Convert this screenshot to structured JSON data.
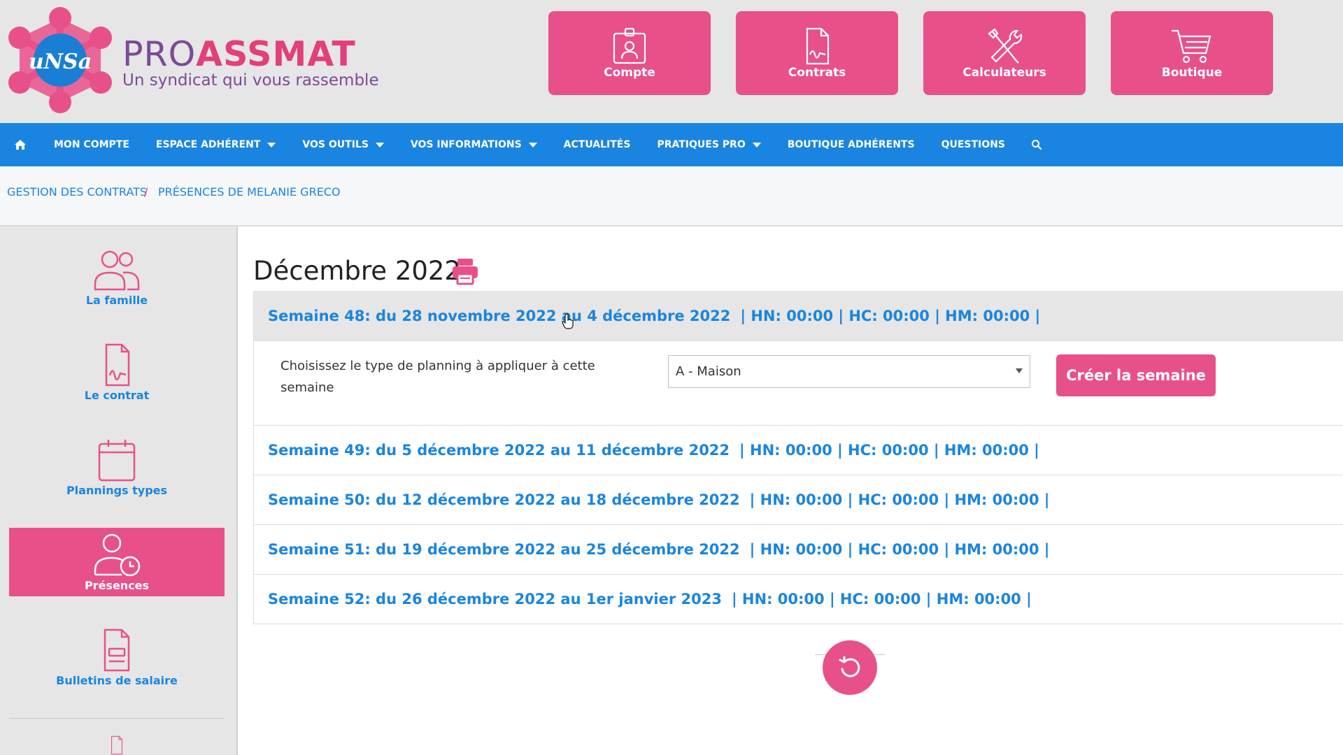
{
  "brand": {
    "logo_text": "uNSa",
    "name_part1": "PRO",
    "name_part2": "ASSMAT",
    "tagline": "Un syndicat qui vous rassemble"
  },
  "colors": {
    "pink": "#e8508a",
    "blue": "#1a85e0",
    "purple": "#7b4b96",
    "header_bg": "#e6e6e6"
  },
  "top_buttons": [
    {
      "label": "Compte",
      "icon": "id-badge-icon"
    },
    {
      "label": "Contrats",
      "icon": "contract-document-icon"
    },
    {
      "label": "Calculateurs",
      "icon": "tools-icon"
    },
    {
      "label": "Boutique",
      "icon": "shopping-cart-icon"
    }
  ],
  "nav": {
    "home_icon": "home-icon",
    "items": [
      {
        "label": "MON COMPTE",
        "dropdown": false
      },
      {
        "label": "ESPACE ADHÉRENT",
        "dropdown": true
      },
      {
        "label": "VOS OUTILS",
        "dropdown": true
      },
      {
        "label": "VOS INFORMATIONS",
        "dropdown": true
      },
      {
        "label": "ACTUALITÉS",
        "dropdown": false
      },
      {
        "label": "PRATIQUES PRO",
        "dropdown": true
      },
      {
        "label": "BOUTIQUE ADHÉRENTS",
        "dropdown": false
      },
      {
        "label": "QUESTIONS",
        "dropdown": false
      }
    ],
    "search_icon": "search-icon"
  },
  "breadcrumb": {
    "items": [
      "GESTION DES CONTRATS",
      "PRÉSENCES DE MELANIE GRECO"
    ],
    "separator": "/"
  },
  "sidebar": {
    "items": [
      {
        "label": "La famille",
        "icon": "family-icon",
        "active": false
      },
      {
        "label": "Le contrat",
        "icon": "contract-icon",
        "active": false
      },
      {
        "label": "Plannings types",
        "icon": "calendar-icon",
        "active": false
      },
      {
        "label": "Présences",
        "icon": "user-clock-icon",
        "active": true
      },
      {
        "label": "Bulletins de salaire",
        "icon": "payslip-icon",
        "active": false
      }
    ]
  },
  "main": {
    "month_title": "Décembre 2022",
    "weeks": [
      {
        "label": "Semaine 48: du 28 novembre 2022 au 4 décembre 2022",
        "sums": "| HN: 00:00 | HC: 00:00 | HM: 00:00 |",
        "open": true
      },
      {
        "label": "Semaine 49: du 5 décembre 2022 au 11 décembre 2022",
        "sums": "| HN: 00:00 | HC: 00:00 | HM: 00:00 |",
        "open": false
      },
      {
        "label": "Semaine 50: du 12 décembre 2022 au 18 décembre 2022",
        "sums": "| HN: 00:00 | HC: 00:00 | HM: 00:00 |",
        "open": false
      },
      {
        "label": "Semaine 51: du 19 décembre 2022 au 25 décembre 2022",
        "sums": "| HN: 00:00 | HC: 00:00 | HM: 00:00 |",
        "open": false
      },
      {
        "label": "Semaine 52: du 26 décembre 2022 au 1er janvier 2023",
        "sums": "| HN: 00:00 | HC: 00:00 | HM: 00:00 |",
        "open": false
      }
    ],
    "panel": {
      "label": "Choisissez le type de planning à appliquer à cette semaine",
      "select_value": "A - Maison",
      "button_label": "Créer la semaine"
    }
  }
}
